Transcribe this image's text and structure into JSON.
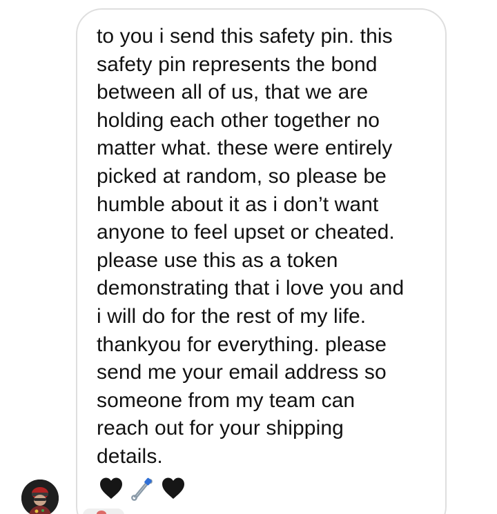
{
  "message": {
    "text_lines": [
      "to you i send this safety pin. this",
      "safety pin represents the bond",
      "between all of us, that we are",
      "holding each other together no",
      "matter what. these were entirely",
      "picked at random, so please be",
      "humble about it as i don’t want",
      "anyone to feel upset or cheated.",
      "please use this as a token",
      "demonstrating that i love you and",
      "i will do for the rest of my life.",
      "thankyou for everything. please",
      "send me your email address so",
      "someone from my team can",
      "reach out for your shipping",
      "details."
    ],
    "emojis": [
      {
        "name": "black-heart-icon",
        "glyph": "🖤"
      },
      {
        "name": "safety-pin-icon",
        "glyph": "🧷"
      },
      {
        "name": "black-heart-icon",
        "glyph": "🖤"
      }
    ]
  },
  "sender": {
    "avatar_icon": "avatar-icon"
  },
  "colors": {
    "bubble_border": "#dedede",
    "text": "#111111",
    "background": "#ffffff"
  }
}
